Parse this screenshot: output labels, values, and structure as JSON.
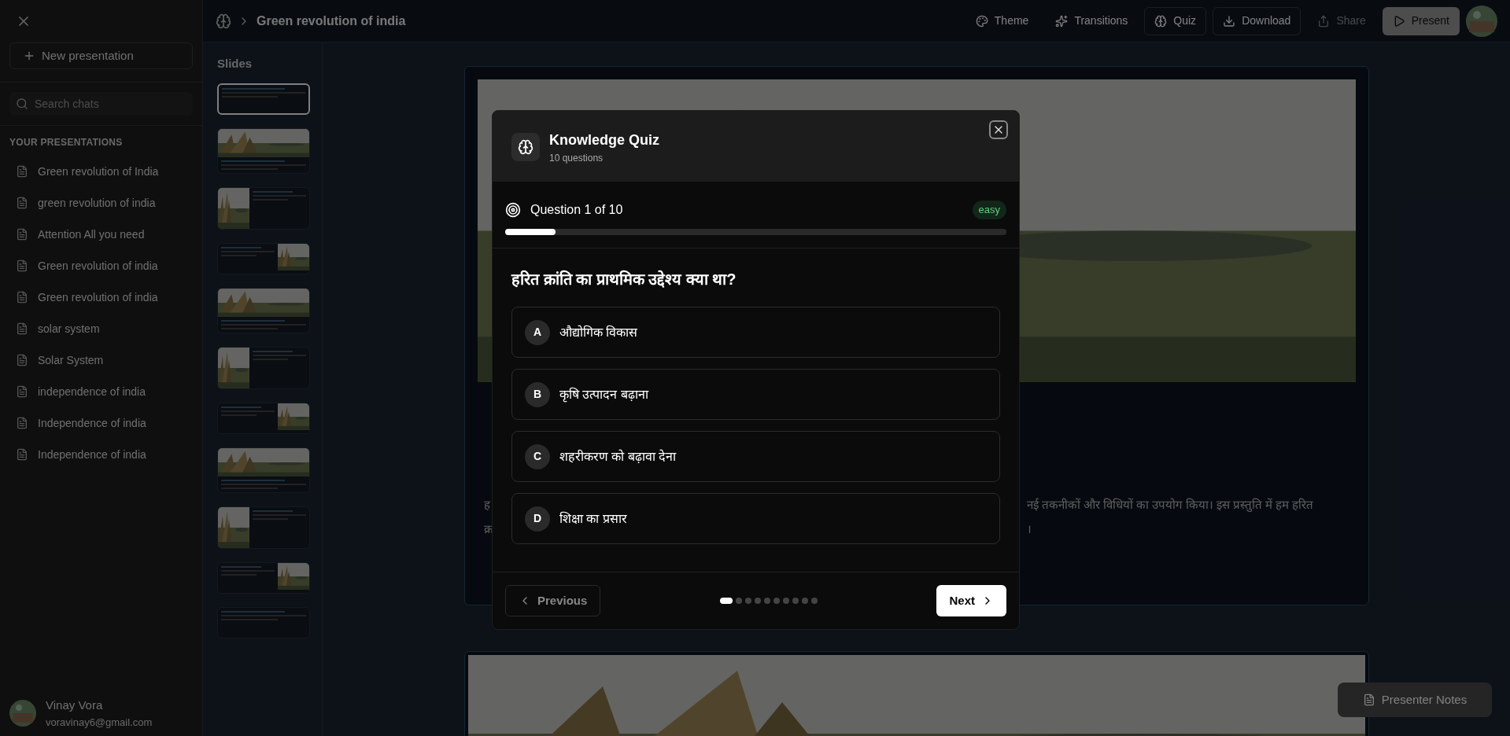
{
  "sidebar": {
    "new_button": "New presentation",
    "search": {
      "placeholder": "Search chats"
    },
    "section_title": "YOUR PRESENTATIONS",
    "presentations": [
      "Green revolution of India",
      "green revolution of india",
      "Attention All you need",
      "Green revolution of india",
      "Green revolution of india",
      "solar system",
      "Solar System",
      "independence of india",
      "Independence of india",
      "Independence of india"
    ],
    "user": {
      "name": "Vinay Vora",
      "email": "voravinay6@gmail.com"
    }
  },
  "topbar": {
    "title": "Green revolution of india",
    "actions": [
      {
        "label": "Theme",
        "kind": "plain",
        "disabled": false
      },
      {
        "label": "Transitions",
        "kind": "plain",
        "disabled": false
      },
      {
        "label": "Quiz",
        "kind": "outlined",
        "disabled": false
      },
      {
        "label": "Download",
        "kind": "outlined",
        "disabled": false
      },
      {
        "label": "Share",
        "kind": "plain",
        "disabled": true
      },
      {
        "label": "Present",
        "kind": "filled",
        "disabled": false
      }
    ]
  },
  "slides_panel": {
    "title": "Slides",
    "slides": [
      {
        "kind": "text",
        "selected": true
      },
      {
        "kind": "image-top",
        "selected": false
      },
      {
        "kind": "image-left",
        "selected": false
      },
      {
        "kind": "image-right",
        "selected": false
      },
      {
        "kind": "image-top",
        "selected": false
      },
      {
        "kind": "image-left",
        "selected": false
      },
      {
        "kind": "image-right",
        "selected": false
      },
      {
        "kind": "image-top",
        "selected": false
      },
      {
        "kind": "image-left",
        "selected": false
      },
      {
        "kind": "image-right",
        "selected": false
      },
      {
        "kind": "text",
        "selected": false
      }
    ]
  },
  "slide_body": {
    "line_1_start": "ह",
    "line_1_end": "नई तकनीकों और विधियों का उपयोग किया। इस प्रस्तुति में हम हरित",
    "line_2_start": "क्र",
    "line_2_end": "।"
  },
  "presenter_notes": "Presenter Notes",
  "quiz": {
    "title": "Knowledge Quiz",
    "subtitle": "10 questions",
    "progress_label": "Question 1 of 10",
    "difficulty": "easy",
    "level": 0.1,
    "question": "हरित क्रांति का प्राथमिक उद्देश्य क्या था?",
    "options": [
      {
        "letter": "A",
        "text": "औद्योगिक विकास",
        "selected": false
      },
      {
        "letter": "B",
        "text": "कृषि उत्पादन बढ़ाना",
        "selected": false
      },
      {
        "letter": "C",
        "text": "शहरीकरण को बढ़ावा देना",
        "selected": false
      },
      {
        "letter": "D",
        "text": "शिक्षा का प्रसार",
        "selected": false
      }
    ],
    "previous": {
      "label": "Previous",
      "disabled": true
    },
    "next": {
      "label": "Next",
      "disabled": false
    },
    "dots": [
      {
        "selected": true
      },
      {
        "selected": false
      },
      {
        "selected": false
      },
      {
        "selected": false
      },
      {
        "selected": false
      },
      {
        "selected": false
      },
      {
        "selected": false
      },
      {
        "selected": false
      },
      {
        "selected": false
      },
      {
        "selected": false
      }
    ]
  }
}
